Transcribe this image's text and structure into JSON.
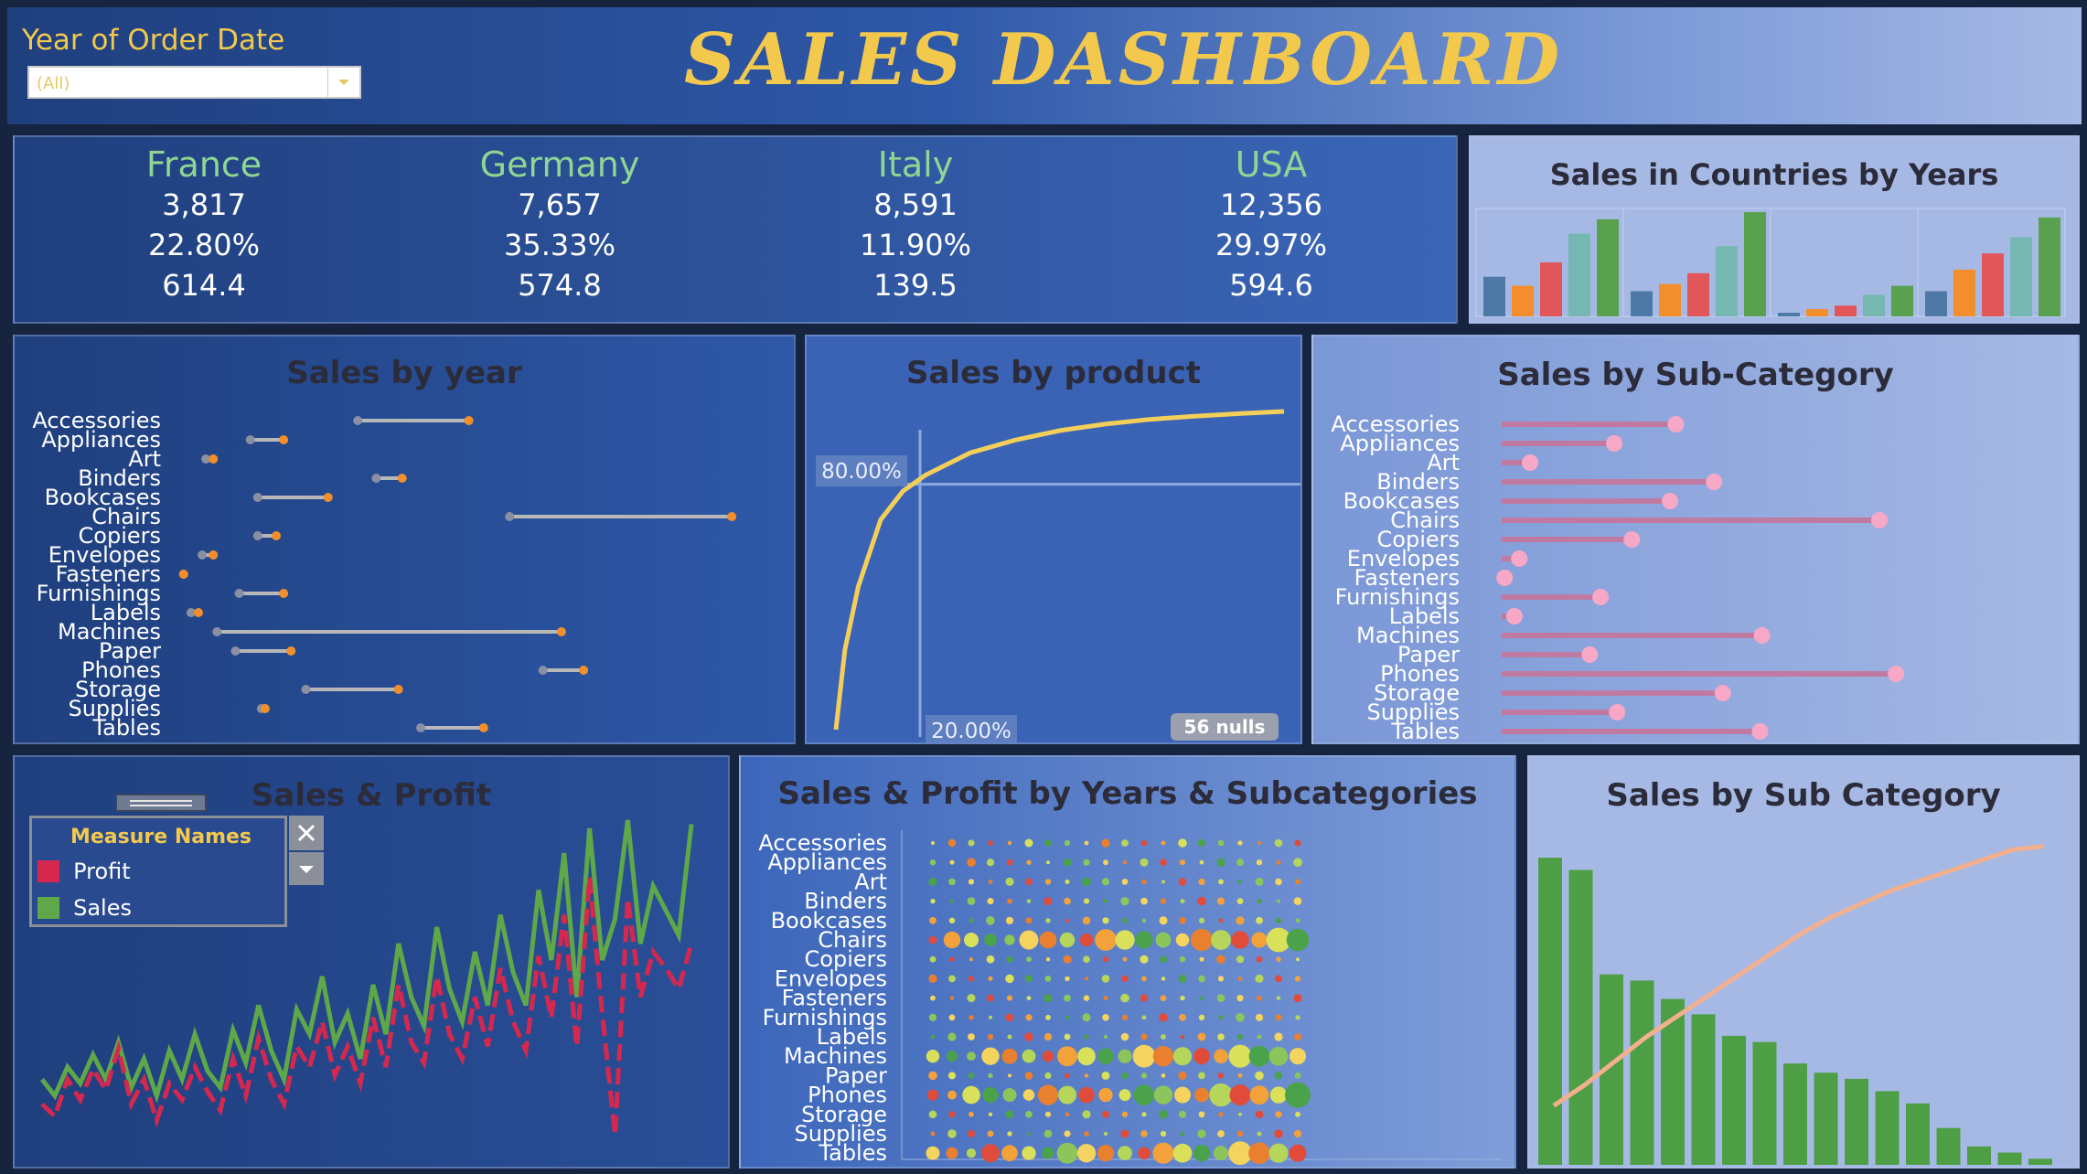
{
  "header": {
    "title": "SALES DASHBOARD",
    "filter_label": "Year of Order Date",
    "filter_value": "(All)"
  },
  "kpis": [
    {
      "country": "France",
      "sales": "3,817",
      "pct": "22.80%",
      "avg": "614.4"
    },
    {
      "country": "Germany",
      "sales": "7,657",
      "pct": "35.33%",
      "avg": "574.8"
    },
    {
      "country": "Italy",
      "sales": "8,591",
      "pct": "11.90%",
      "avg": "139.5"
    },
    {
      "country": "USA",
      "sales": "12,356",
      "pct": "29.97%",
      "avg": "594.6"
    }
  ],
  "colors": {
    "title_gold": "#f2c94c",
    "country_green": "#8fd694",
    "profit": "#d6284f",
    "sales": "#5fa84a",
    "pareto_line": "#f3cf5a",
    "lollipop_pink": "#f7a8c6",
    "bar_green": "#4e9e46"
  },
  "sub_categories": [
    "Accessories",
    "Appliances",
    "Art",
    "Binders",
    "Bookcases",
    "Chairs",
    "Copiers",
    "Envelopes",
    "Fasteners",
    "Furnishings",
    "Labels",
    "Machines",
    "Paper",
    "Phones",
    "Storage",
    "Supplies",
    "Tables"
  ],
  "chart_data": [
    {
      "id": "countries_by_years",
      "type": "bar",
      "title": "Sales in Countries by Years",
      "categories": [
        "France",
        "Germany",
        "Italy",
        "USA"
      ],
      "series_colors": [
        "#4e79a7",
        "#f28e2b",
        "#e15759",
        "#76b7b2",
        "#59a14f"
      ],
      "values": [
        [
          22,
          17,
          30,
          46,
          54
        ],
        [
          14,
          18,
          24,
          39,
          58
        ],
        [
          2,
          4,
          6,
          12,
          17
        ],
        [
          14,
          26,
          35,
          44,
          55
        ]
      ]
    },
    {
      "id": "sales_by_year",
      "type": "dumbbell",
      "title": "Sales by year",
      "categories": [
        "Accessories",
        "Appliances",
        "Art",
        "Binders",
        "Bookcases",
        "Chairs",
        "Copiers",
        "Envelopes",
        "Fasteners",
        "Furnishings",
        "Labels",
        "Machines",
        "Paper",
        "Phones",
        "Storage",
        "Supplies",
        "Tables"
      ],
      "start": [
        63,
        34,
        22,
        68,
        36,
        104,
        36,
        21,
        16,
        31,
        18,
        25,
        30,
        113,
        49,
        37,
        80
      ],
      "end": [
        93,
        43,
        24,
        75,
        55,
        164,
        41,
        24,
        16,
        43,
        20,
        118,
        45,
        124,
        74,
        38,
        97
      ]
    },
    {
      "id": "sales_by_product",
      "type": "line",
      "title": "Sales by product",
      "x": [
        0,
        2,
        5,
        10,
        15,
        20,
        30,
        40,
        50,
        60,
        70,
        80,
        90,
        100
      ],
      "y": [
        0,
        25,
        45,
        66,
        75,
        80,
        87,
        91,
        94,
        96,
        97.5,
        98.5,
        99.3,
        100
      ],
      "annotations": [
        "80.00%",
        "20.00%",
        "56 nulls"
      ]
    },
    {
      "id": "sales_by_subcategory_lollipop",
      "type": "lollipop",
      "title": "Sales by Sub-Category",
      "categories": [
        "Accessories",
        "Appliances",
        "Art",
        "Binders",
        "Bookcases",
        "Chairs",
        "Copiers",
        "Envelopes",
        "Fasteners",
        "Furnishings",
        "Labels",
        "Machines",
        "Paper",
        "Phones",
        "Storage",
        "Supplies",
        "Tables"
      ],
      "values": [
        178,
        115,
        29,
        217,
        172,
        386,
        133,
        18,
        3,
        101,
        13,
        266,
        90,
        403,
        226,
        118,
        264
      ]
    },
    {
      "id": "sales_and_profit",
      "type": "line",
      "title": "Sales & Profit",
      "legend_title": "Measure Names",
      "series": [
        {
          "name": "Profit",
          "values": [
            18,
            12,
            30,
            20,
            35,
            25,
            45,
            18,
            30,
            10,
            28,
            20,
            36,
            24,
            15,
            40,
            22,
            50,
            30,
            18,
            46,
            36,
            58,
            32,
            46,
            28,
            60,
            36,
            76,
            48,
            38,
            80,
            52,
            40,
            70,
            46,
            84,
            58,
            44,
            90,
            60,
            110,
            46,
            128,
            62,
            3,
            118,
            70,
            92,
            84,
            74,
            96
          ]
        },
        {
          "name": "Sales",
          "values": [
            30,
            22,
            36,
            28,
            42,
            30,
            48,
            26,
            40,
            22,
            44,
            30,
            52,
            34,
            26,
            54,
            38,
            66,
            44,
            30,
            64,
            52,
            80,
            48,
            62,
            40,
            76,
            52,
            96,
            70,
            56,
            104,
            74,
            58,
            92,
            66,
            110,
            82,
            66,
            122,
            88,
            140,
            70,
            152,
            88,
            108,
            156,
            96,
            124,
            112,
            100,
            154
          ]
        }
      ]
    },
    {
      "id": "sales_profit_years_subcats",
      "type": "scatter",
      "title": "Sales & Profit by Years & Subcategories",
      "categories": [
        "Accessories",
        "Appliances",
        "Art",
        "Binders",
        "Bookcases",
        "Chairs",
        "Copiers",
        "Envelopes",
        "Fasteners",
        "Furnishings",
        "Labels",
        "Machines",
        "Paper",
        "Phones",
        "Storage",
        "Supplies",
        "Tables"
      ],
      "columns": 20
    },
    {
      "id": "sales_by_sub_category_pareto",
      "type": "bar",
      "title": "Sales by Sub Category",
      "values": [
        100,
        96,
        62,
        60,
        54,
        49,
        42,
        40,
        33,
        30,
        28,
        24,
        20,
        12,
        6,
        4,
        2
      ],
      "cumulative": [
        12,
        18,
        25,
        32,
        38,
        44,
        50,
        56,
        62,
        67,
        71,
        75,
        78,
        81,
        84,
        87,
        88
      ]
    }
  ]
}
